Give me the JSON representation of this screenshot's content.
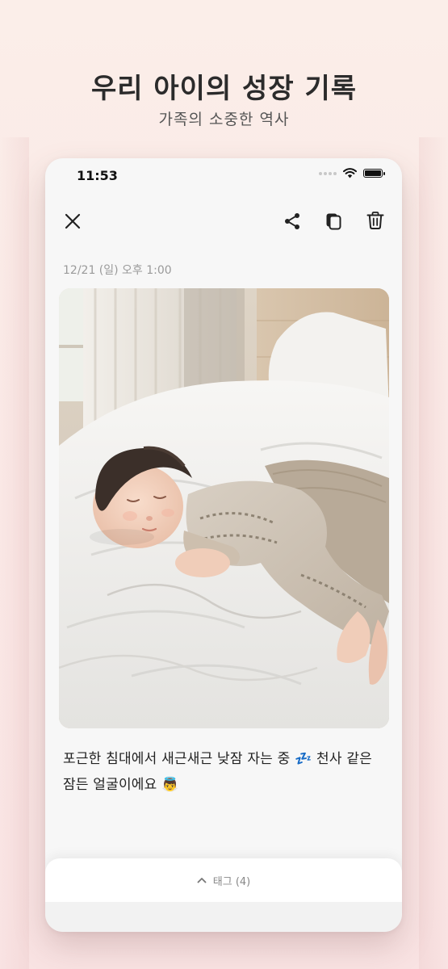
{
  "header": {
    "title": "우리 아이의 성장 기록",
    "subtitle": "가족의 소중한 역사"
  },
  "status_bar": {
    "time": "11:53"
  },
  "toolbar": {
    "close_icon": "close-icon",
    "share_icon": "share-icon",
    "copy_icon": "copy-icon",
    "delete_icon": "trash-icon"
  },
  "post": {
    "date": "12/21 (일) 오후 1:00",
    "photo_description": "baby-sleeping-photo",
    "caption": "포근한 침대에서 새근새근 낮잠 자는 중 💤 천사 같은 잠든 얼굴이에요 👼"
  },
  "tags": {
    "label": "태그 (4)",
    "chevron_icon": "chevron-up-icon"
  },
  "colors": {
    "background": "#fbeee9",
    "card": "#f7f7f7",
    "text_primary": "#222222",
    "text_muted": "#9a9a9a"
  }
}
